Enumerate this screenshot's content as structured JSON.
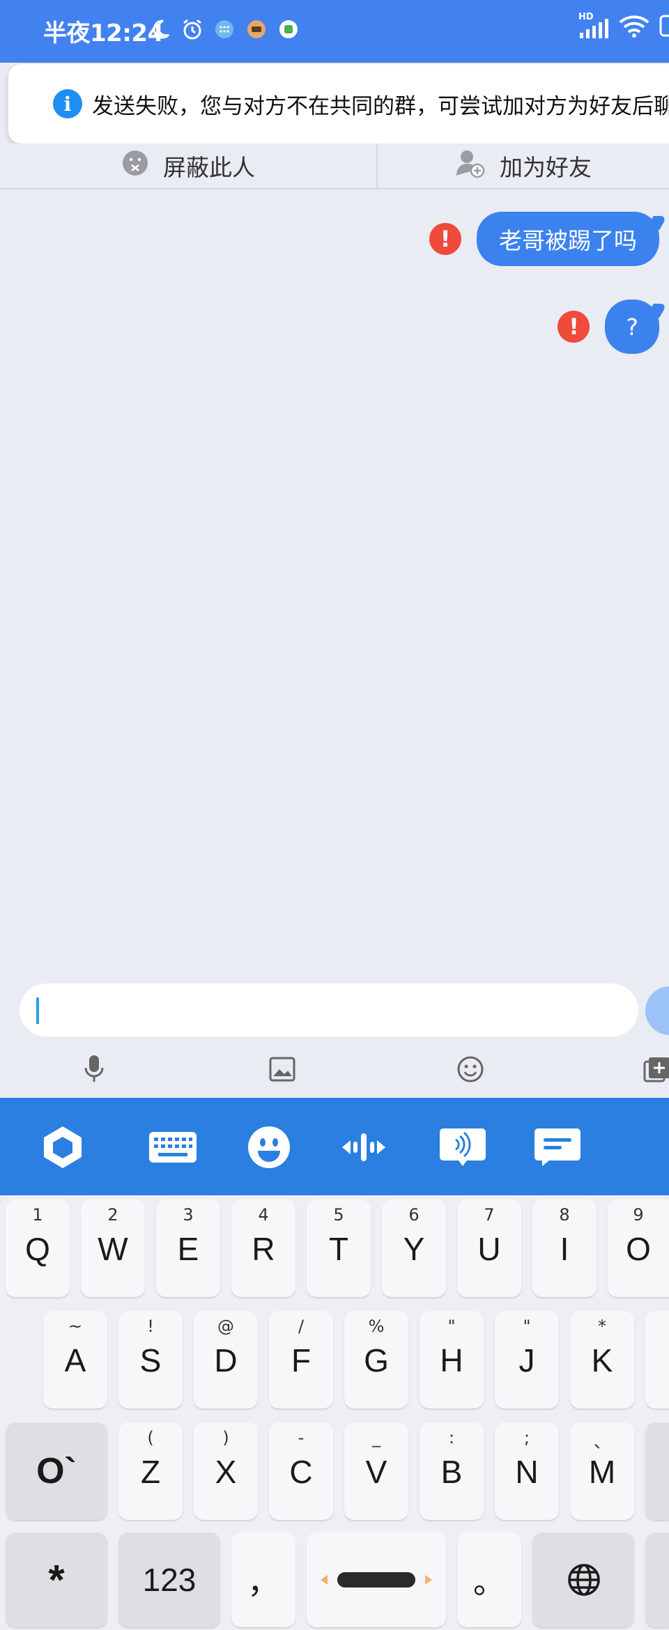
{
  "status_bar": {
    "time": "半夜12:24",
    "left_icons": [
      "moon-icon",
      "alarm-icon",
      "app-notification-icon",
      "app-notification-icon-2",
      "app-notification-icon-3"
    ],
    "right_icons": [
      "hd-signal-icon",
      "wifi-icon",
      "battery-icon"
    ],
    "hd_label": "HD"
  },
  "notice": {
    "icon": "info-icon",
    "icon_glyph": "i",
    "text": "发送失败，您与对方不在共同的群，可尝试加对方为好友后聊"
  },
  "actions": {
    "block": {
      "label": "屏蔽此人",
      "icon": "block-icon"
    },
    "add_friend": {
      "label": "加为好友",
      "icon": "add-friend-icon"
    }
  },
  "messages": [
    {
      "text": "老哥被踢了吗",
      "status": "failed",
      "status_glyph": "!"
    },
    {
      "text": "?",
      "status": "failed",
      "status_glyph": "!"
    }
  ],
  "input": {
    "value": "",
    "placeholder": ""
  },
  "toolbar": [
    "mic-icon",
    "image-icon",
    "emoji-icon",
    "more-icon"
  ],
  "keyboard_toolbar": [
    "keyboard-logo-icon",
    "keyboard-icon",
    "emoji-icon",
    "cursor-move-icon",
    "voice-input-icon",
    "clipboard-icon"
  ],
  "keyboard": {
    "row1": [
      {
        "key": "Q",
        "sub": "1"
      },
      {
        "key": "W",
        "sub": "2"
      },
      {
        "key": "E",
        "sub": "3"
      },
      {
        "key": "R",
        "sub": "4"
      },
      {
        "key": "T",
        "sub": "5"
      },
      {
        "key": "Y",
        "sub": "6"
      },
      {
        "key": "U",
        "sub": "7"
      },
      {
        "key": "I",
        "sub": "8"
      },
      {
        "key": "O",
        "sub": "9"
      }
    ],
    "row2": [
      {
        "key": "A",
        "sub": "~"
      },
      {
        "key": "S",
        "sub": "!"
      },
      {
        "key": "D",
        "sub": "@"
      },
      {
        "key": "F",
        "sub": "/"
      },
      {
        "key": "G",
        "sub": "%"
      },
      {
        "key": "H",
        "sub": "\""
      },
      {
        "key": "J",
        "sub": "\""
      },
      {
        "key": "K",
        "sub": "*"
      }
    ],
    "row3": [
      {
        "key": "Z",
        "sub": "("
      },
      {
        "key": "X",
        "sub": ")"
      },
      {
        "key": "C",
        "sub": "-"
      },
      {
        "key": "V",
        "sub": "_"
      },
      {
        "key": "B",
        "sub": ":"
      },
      {
        "key": "N",
        "sub": ";"
      },
      {
        "key": "M",
        "sub": "、"
      }
    ],
    "row3_left": "O`",
    "row4": {
      "symbol": "*",
      "num": "123",
      "comma": "，",
      "period": "。",
      "lang_icon": "globe-icon"
    }
  },
  "colors": {
    "accent": "#4281f0",
    "bubble": "#3c82ee",
    "error": "#f04a3a",
    "keyboard_bar": "#2a7fe0"
  }
}
